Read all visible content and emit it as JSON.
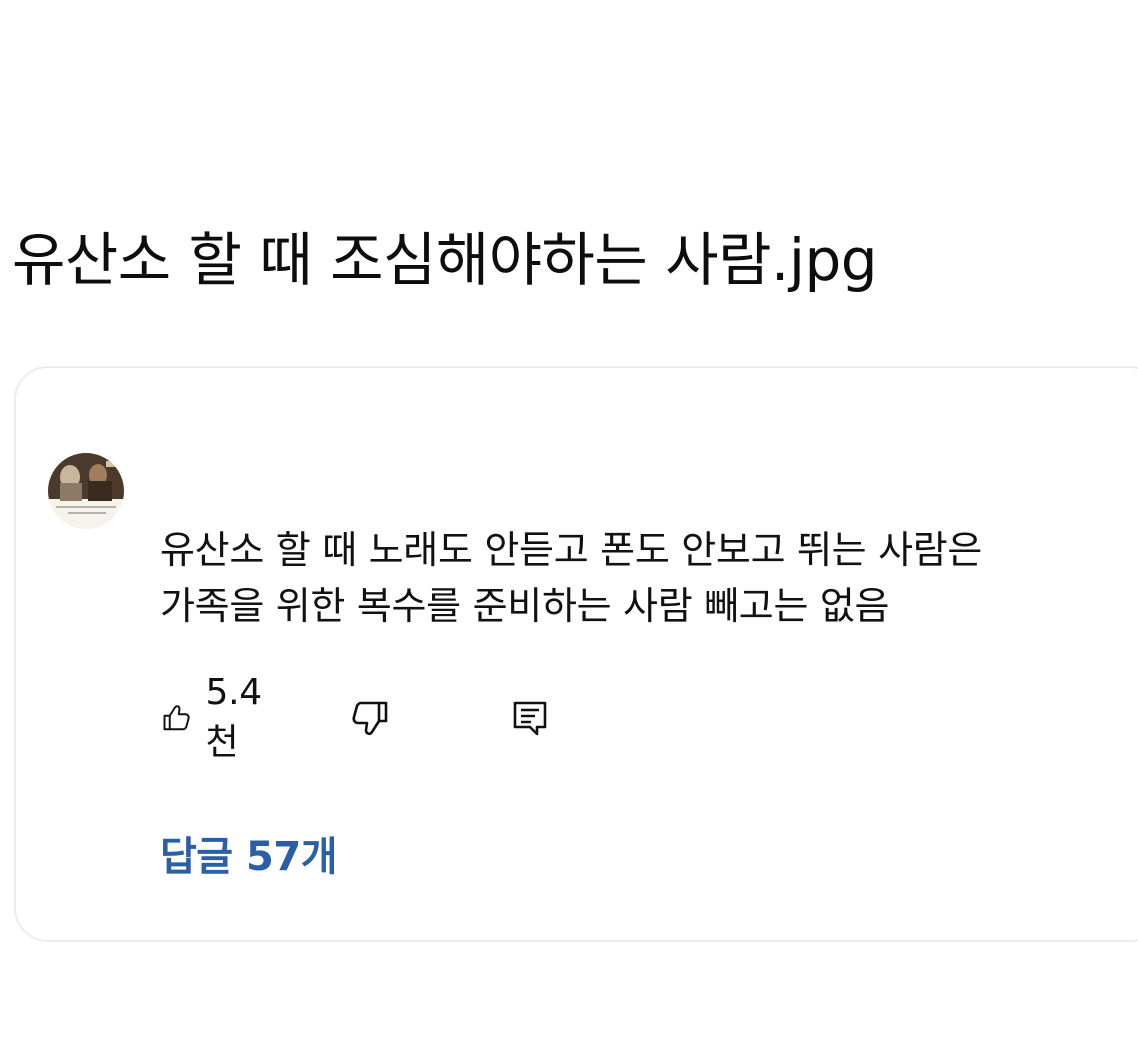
{
  "post": {
    "title": "유산소 할 때 조심해야하는 사람.jpg"
  },
  "comment": {
    "avatar_icon": "avatar-image",
    "text_lines": [
      "유산소 할 때 노래도 안듣고 폰도 안보고 뛰는 사람은",
      "가족을 위한 복수를 준비하는 사람 빼고는 없음"
    ],
    "likes": "5.4천",
    "icons": {
      "like": "thumbs-up-icon",
      "dislike": "thumbs-down-icon",
      "reply": "reply-icon"
    },
    "replies_label": "답글 57개"
  },
  "colors": {
    "text": "#111111",
    "link": "#2a5fa8",
    "card_border": "#ececec",
    "background": "#ffffff"
  }
}
